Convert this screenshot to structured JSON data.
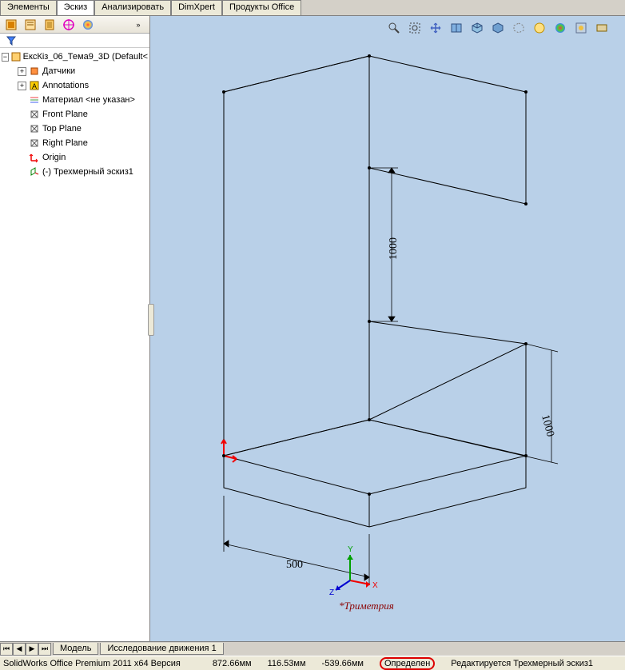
{
  "top_tabs": {
    "items": [
      "Элементы",
      "Эскиз",
      "Анализировать",
      "DimXpert",
      "Продукты Office"
    ],
    "active_index": 1
  },
  "panel_toolbar": {
    "icons": [
      "feature-tree-icon",
      "property-icon",
      "config-icon",
      "dimxpert-target-icon",
      "appearance-icon"
    ],
    "overflow": "»"
  },
  "filter_icon": "filter-icon",
  "tree": {
    "root": {
      "label": "ЕксКіз_06_Тема9_3D  (Default<",
      "icon": "part-icon"
    },
    "items": [
      {
        "label": "Датчики",
        "icon": "sensor-icon",
        "exp": "+"
      },
      {
        "label": "Annotations",
        "icon": "annotations-icon",
        "exp": "+"
      },
      {
        "label": "Материал <не указан>",
        "icon": "material-icon"
      },
      {
        "label": "Front Plane",
        "icon": "plane-icon"
      },
      {
        "label": "Top Plane",
        "icon": "plane-icon"
      },
      {
        "label": "Right Plane",
        "icon": "plane-icon"
      },
      {
        "label": "Origin",
        "icon": "origin-icon"
      },
      {
        "label": "(-) Трехмерный эскиз1",
        "icon": "sketch3d-icon"
      }
    ]
  },
  "viewport_toolbar": {
    "icons": [
      "zoom-icon",
      "zoom-area-icon",
      "pan-icon",
      "section-icon",
      "view-orient-icon",
      "display-style-icon",
      "hide-show-icon",
      "scene-icon",
      "appearance-sphere-icon",
      "render-icon",
      "settings-icon"
    ]
  },
  "dimensions": {
    "d1": "500",
    "d2": "1000",
    "d3": "1000"
  },
  "triad_label": "*Триметрия",
  "triad_axes": {
    "x": "X",
    "y": "Y",
    "z": "Z"
  },
  "bottom_tabs": {
    "items": [
      "Модель",
      "Исследование движения 1"
    ]
  },
  "status": {
    "product": "SolidWorks Office Premium 2011 x64 Версия",
    "coord1": "872.66мм",
    "coord2": "116.53мм",
    "coord3": "-539.66мм",
    "define": "Определен",
    "editing": "Редактируется Трехмерный эскиз1"
  }
}
